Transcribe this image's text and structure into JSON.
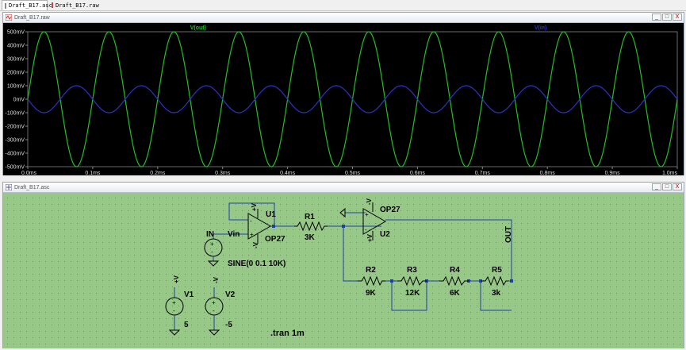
{
  "tabs": [
    {
      "label": "Draft_B17.asc"
    },
    {
      "label": "Draft_B17.raw"
    }
  ],
  "plot_window": {
    "title": "Draft_B17.raw",
    "controls": [
      "_",
      "□",
      "X"
    ]
  },
  "schematic_window": {
    "title": "Draft_B17.asc",
    "controls": [
      "_",
      "□",
      "X"
    ]
  },
  "chart_data": {
    "type": "line",
    "series": [
      {
        "name": "V(out)",
        "color": "#22c022",
        "amplitude": 0.5,
        "frequency_hz": 10000,
        "phase": "sine"
      },
      {
        "name": "V(in)",
        "color": "#3030c8",
        "amplitude": 0.1,
        "frequency_hz": 10000,
        "phase": "inverted"
      }
    ],
    "x_ticks": [
      "0.0ms",
      "0.1ms",
      "0.2ms",
      "0.3ms",
      "0.4ms",
      "0.5ms",
      "0.6ms",
      "0.7ms",
      "0.8ms",
      "0.9ms",
      "1.0ms"
    ],
    "y_ticks": [
      "500mV",
      "400mV",
      "300mV",
      "200mV",
      "100mV",
      "0mV",
      "-100mV",
      "-200mV",
      "-300mV",
      "-400mV",
      "-500mV"
    ],
    "xlim": [
      0,
      1.0
    ],
    "ylim": [
      -0.5,
      0.5
    ],
    "x_unit": "ms",
    "grid": false,
    "background": "#000000"
  },
  "schematic": {
    "background": "#98c888",
    "wire_color": "#1f3fa8",
    "component_color": "#000000",
    "labels": {
      "u1": "U1",
      "u1_model": "OP27",
      "u2": "U2",
      "u2_model": "OP27",
      "r1": "R1",
      "r1_val": "3K",
      "r2": "R2",
      "r2_val": "9K",
      "r3": "R3",
      "r3_val": "12K",
      "r4": "R4",
      "r4_val": "6K",
      "r5": "R5",
      "r5_val": "3k",
      "v1": "V1",
      "v1_val": "5",
      "v2": "V2",
      "v2_val": "-5",
      "vin_net": "IN",
      "vin_pin": "Vin",
      "source": "SINE(0 0.1 10K)",
      "out": "OUT",
      "tran": ".tran 1m",
      "plus_v": "+V",
      "minus_v": "-V",
      "plus_sign": "+",
      "minus_sign": "-"
    }
  }
}
